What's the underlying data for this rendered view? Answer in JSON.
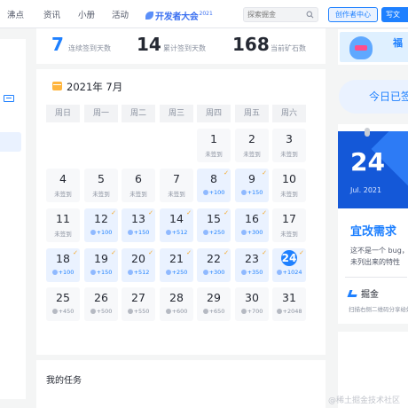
{
  "nav": {
    "links": [
      "沸点",
      "资讯",
      "小册",
      "活动"
    ],
    "event_logo": "开发者大会",
    "event_year": "2021",
    "search_placeholder": "探索掘金",
    "creator_button": "创作者中心",
    "write_button": "写文"
  },
  "stats": [
    {
      "value": "7",
      "label": "连续签到天数"
    },
    {
      "value": "14",
      "label": "累计签到天数"
    },
    {
      "value": "168",
      "label": "当前矿石数"
    }
  ],
  "calendar": {
    "title": "2021年 7月",
    "weekdays": [
      "周日",
      "周一",
      "周二",
      "周三",
      "周四",
      "周五",
      "周六"
    ],
    "unsigned_label": "未签到",
    "days": [
      {
        "day": "1",
        "sub": "未签到",
        "status": "unsigned"
      },
      {
        "day": "2",
        "sub": "未签到",
        "status": "unsigned"
      },
      {
        "day": "3",
        "sub": "未签到",
        "status": "unsigned"
      },
      {
        "day": "4",
        "sub": "未签到",
        "status": "unsigned"
      },
      {
        "day": "5",
        "sub": "未签到",
        "status": "unsigned"
      },
      {
        "day": "6",
        "sub": "未签到",
        "status": "unsigned"
      },
      {
        "day": "7",
        "sub": "未签到",
        "status": "unsigned"
      },
      {
        "day": "8",
        "sub": "+100",
        "status": "signed"
      },
      {
        "day": "9",
        "sub": "+150",
        "status": "signed"
      },
      {
        "day": "10",
        "sub": "未签到",
        "status": "unsigned"
      },
      {
        "day": "11",
        "sub": "未签到",
        "status": "unsigned"
      },
      {
        "day": "12",
        "sub": "+100",
        "status": "signed"
      },
      {
        "day": "13",
        "sub": "+150",
        "status": "signed"
      },
      {
        "day": "14",
        "sub": "+512",
        "status": "signed"
      },
      {
        "day": "15",
        "sub": "+250",
        "status": "signed"
      },
      {
        "day": "16",
        "sub": "+300",
        "status": "signed"
      },
      {
        "day": "17",
        "sub": "未签到",
        "status": "unsigned"
      },
      {
        "day": "18",
        "sub": "+100",
        "status": "signed"
      },
      {
        "day": "19",
        "sub": "+150",
        "status": "signed"
      },
      {
        "day": "20",
        "sub": "+512",
        "status": "signed"
      },
      {
        "day": "21",
        "sub": "+250",
        "status": "signed"
      },
      {
        "day": "22",
        "sub": "+300",
        "status": "signed"
      },
      {
        "day": "23",
        "sub": "+350",
        "status": "signed"
      },
      {
        "day": "24",
        "sub": "+1024",
        "status": "today"
      },
      {
        "day": "25",
        "sub": "+450",
        "status": "future"
      },
      {
        "day": "26",
        "sub": "+500",
        "status": "future"
      },
      {
        "day": "27",
        "sub": "+550",
        "status": "future"
      },
      {
        "day": "28",
        "sub": "+600",
        "status": "future"
      },
      {
        "day": "29",
        "sub": "+650",
        "status": "future"
      },
      {
        "day": "30",
        "sub": "+700",
        "status": "future"
      },
      {
        "day": "31",
        "sub": "+2048",
        "status": "future"
      }
    ]
  },
  "tasks": {
    "title": "我的任务"
  },
  "sidebar_right": {
    "promo_text": "福",
    "signed_button": "今日已签",
    "card_day": "24",
    "card_month": "Jul. 2021",
    "card_title": "宜改需求",
    "card_text_1": "这不是一个 bug，这",
    "card_text_2": "未列出来的特性",
    "card_brand": "掘金",
    "card_scan": "扫描右侧二维码分享给好友"
  },
  "watermark": "@稀土掘金技术社区",
  "colors": {
    "accent": "#1e80ff",
    "check": "#f5a623",
    "calendar_icon": "#ffb53d"
  }
}
